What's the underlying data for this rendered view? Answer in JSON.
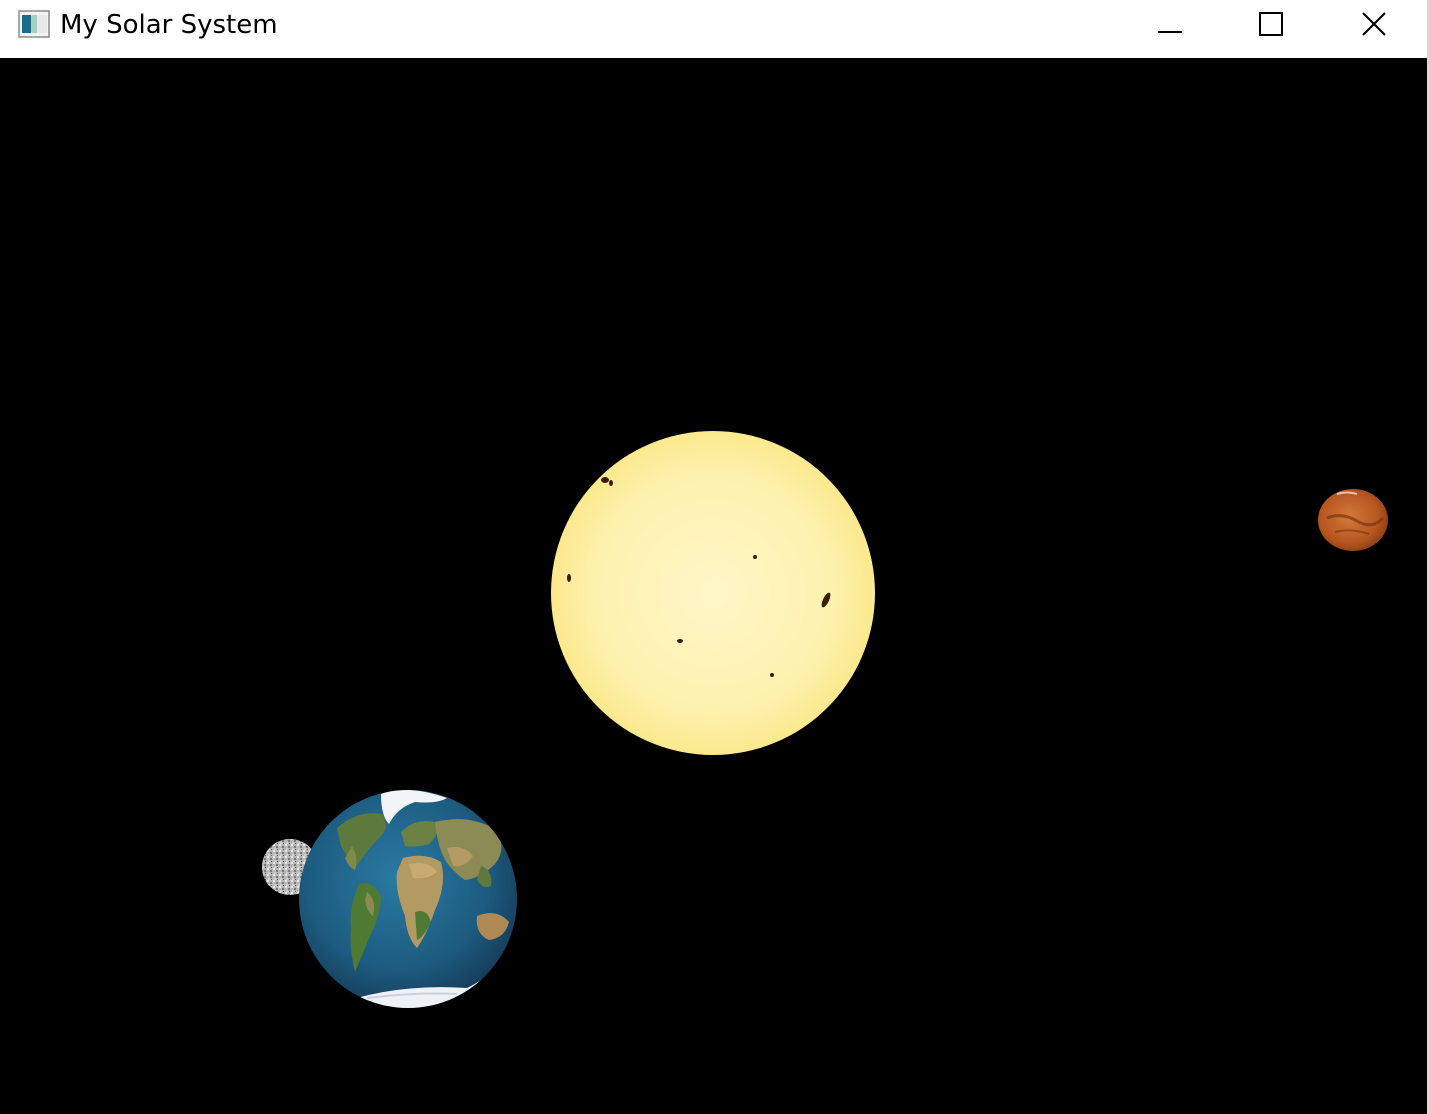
{
  "window": {
    "title": "My Solar System"
  },
  "caption_buttons": {
    "minimize": "minimize-icon",
    "maximize": "maximize-icon",
    "close": "close-icon"
  },
  "scene": {
    "background_color": "#000000",
    "bodies": [
      {
        "name": "sun",
        "color": "#fdf3b2"
      },
      {
        "name": "mars",
        "color": "#c1602a"
      },
      {
        "name": "earth",
        "color": "#1f5f86"
      },
      {
        "name": "moon",
        "color": "#b5b5b5"
      }
    ]
  }
}
